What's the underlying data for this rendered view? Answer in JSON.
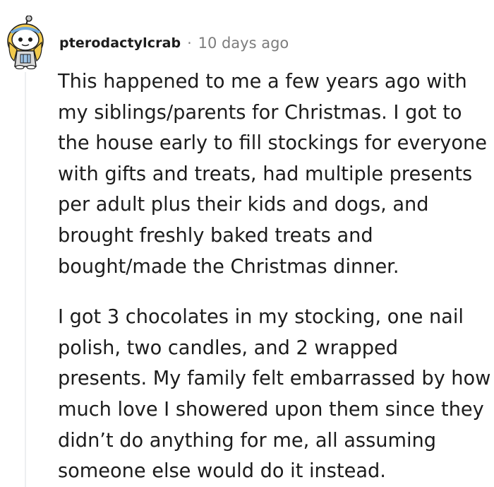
{
  "comment": {
    "username": "pterodactylcrab",
    "separator": "·",
    "timestamp": "10 days ago",
    "avatar_icon": "reddit-snoo-avatar-icon",
    "paragraphs": [
      {
        "lines": [
          "This happened to me a few years ago with",
          "my siblings/parents for Christmas. I got to",
          "the house early to fill stockings for everyone",
          "with gifts and treats, had multiple presents",
          "per adult plus their kids and dogs, and",
          "brought freshly baked treats and",
          "bought/made the Christmas dinner."
        ]
      },
      {
        "lines": [
          "I got 3 chocolates in my stocking, one nail",
          "polish, two candles, and 2 wrapped",
          "presents. My family felt embarrassed by how",
          "much love I showered upon them since they",
          "didn’t do anything for me, all assuming",
          "someone else would do it instead."
        ]
      }
    ]
  },
  "colors": {
    "text": "#1c1c1c",
    "meta": "#7c7c7c",
    "thread_line": "#edeff1"
  }
}
